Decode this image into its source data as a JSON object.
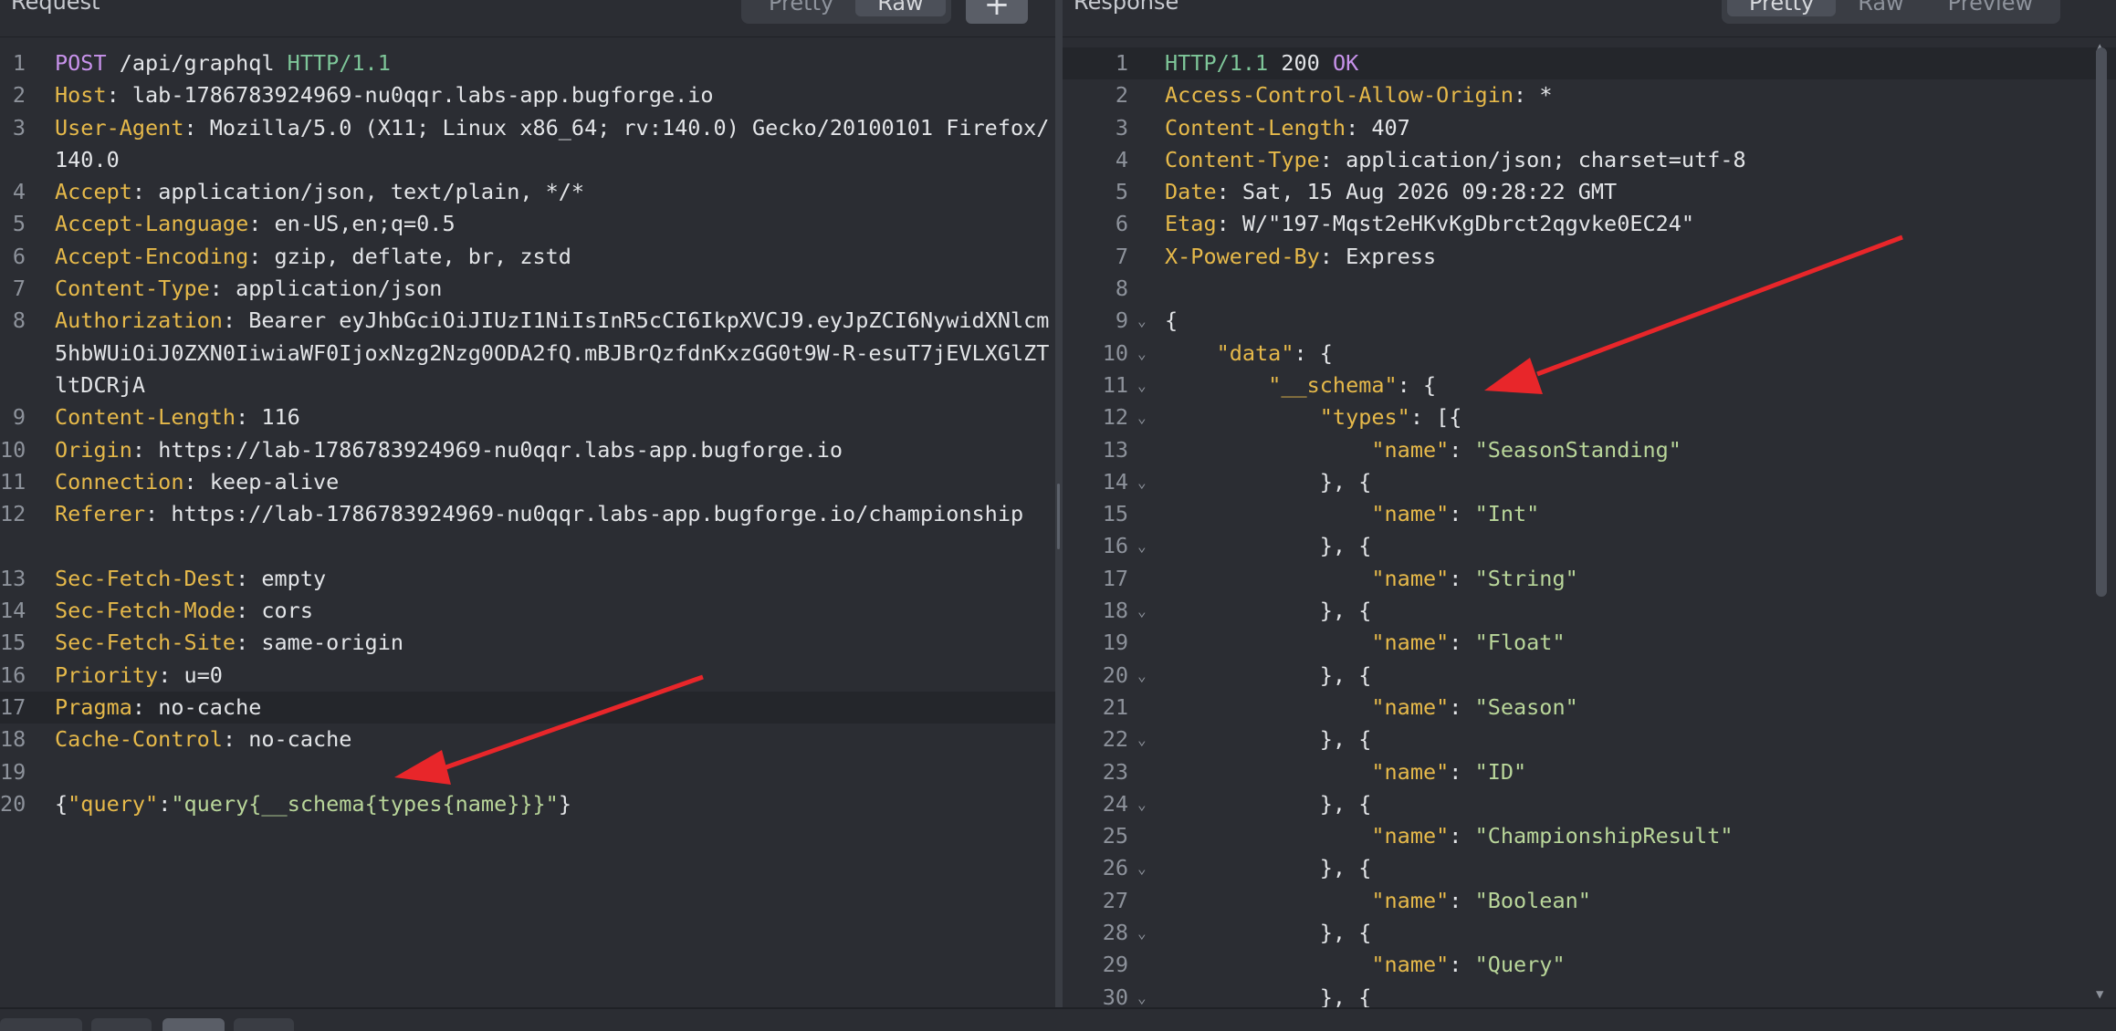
{
  "request": {
    "title": "Request",
    "tabs": [
      {
        "label": "Pretty"
      },
      {
        "label": "Raw"
      }
    ],
    "active_tab": "Raw",
    "add_label": "+",
    "lines": [
      {
        "n": "1",
        "method": "POST",
        "path": " /api/graphql ",
        "proto": "HTTP/1.1"
      },
      {
        "n": "2",
        "key": "Host",
        "value": "lab-1786783924969-nu0qqr.labs-app.bugforge.io"
      },
      {
        "n": "3",
        "key": "User-Agent",
        "value": "Mozilla/5.0 (X11; Linux x86_64; rv:140.0) Gecko/20100101 Firefox/140.0"
      },
      {
        "n": "4",
        "key": "Accept",
        "value": "application/json, text/plain, */*"
      },
      {
        "n": "5",
        "key": "Accept-Language",
        "value": "en-US,en;q=0.5"
      },
      {
        "n": "6",
        "key": "Accept-Encoding",
        "value": "gzip, deflate, br, zstd"
      },
      {
        "n": "7",
        "key": "Content-Type",
        "value": "application/json"
      },
      {
        "n": "8",
        "key": "Authorization",
        "value": "Bearer eyJhbGciOiJIUzI1NiIsInR5cCI6IkpXVCJ9.eyJpZCI6NywidXNlcm5hbWUiOiJ0ZXN0IiwiaWF0IjoxNzg2Nzg0ODA2fQ.mBJBrQzfdnKxzGG0t9W-R-esuT7jEVLXGlZTltDCRjA"
      },
      {
        "n": "9",
        "key": "Content-Length",
        "value": "116"
      },
      {
        "n": "10",
        "key": "Origin",
        "value": "https://lab-1786783924969-nu0qqr.labs-app.bugforge.io"
      },
      {
        "n": "11",
        "key": "Connection",
        "value": "keep-alive"
      },
      {
        "n": "12",
        "key": "Referer",
        "value": "https://lab-1786783924969-nu0qqr.labs-app.bugforge.io/championship"
      },
      {
        "n": "13",
        "key": "Sec-Fetch-Dest",
        "value": "empty"
      },
      {
        "n": "14",
        "key": "Sec-Fetch-Mode",
        "value": "cors"
      },
      {
        "n": "15",
        "key": "Sec-Fetch-Site",
        "value": "same-origin"
      },
      {
        "n": "16",
        "key": "Priority",
        "value": "u=0"
      },
      {
        "n": "17",
        "key": "Pragma",
        "value": "no-cache"
      },
      {
        "n": "18",
        "key": "Cache-Control",
        "value": "no-cache"
      },
      {
        "n": "19"
      },
      {
        "n": "20",
        "b1": "{",
        "k": "\"query\"",
        "colon": ":",
        "v": "\"query{__schema{types{name}}}\"",
        "b2": "}"
      }
    ]
  },
  "response": {
    "title": "Response",
    "tabs": [
      {
        "label": "Pretty"
      },
      {
        "label": "Raw"
      },
      {
        "label": "Preview"
      }
    ],
    "active_tab": "Pretty",
    "status_line": {
      "proto": "HTTP/1.1",
      "code": "200",
      "reason": "OK"
    },
    "headers": [
      {
        "n": "2",
        "key": "Access-Control-Allow-Origin",
        "value": "*"
      },
      {
        "n": "3",
        "key": "Content-Length",
        "value": "407"
      },
      {
        "n": "4",
        "key": "Content-Type",
        "value": "application/json; charset=utf-8"
      },
      {
        "n": "5",
        "key": "Date",
        "value": "Sat, 15 Aug 2026 09:28:22 GMT"
      },
      {
        "n": "6",
        "key": "Etag",
        "value": "W/\"197-Mqst2eHKvKgDbrct2qgvke0EC24\""
      },
      {
        "n": "7",
        "key": "X-Powered-By",
        "value": "Express"
      }
    ],
    "body_lines": [
      {
        "n": "8",
        "fold": false,
        "indent": "",
        "parts": []
      },
      {
        "n": "9",
        "fold": true,
        "indent": "",
        "parts": [
          {
            "c": "jpunct",
            "t": "{"
          }
        ]
      },
      {
        "n": "10",
        "fold": true,
        "indent": "    ",
        "parts": [
          {
            "c": "jkey",
            "t": "\"data\""
          },
          {
            "c": "jpunct",
            "t": ": {"
          }
        ]
      },
      {
        "n": "11",
        "fold": true,
        "indent": "        ",
        "parts": [
          {
            "c": "jkey",
            "t": "\"__schema\""
          },
          {
            "c": "jpunct",
            "t": ": {"
          }
        ]
      },
      {
        "n": "12",
        "fold": true,
        "indent": "            ",
        "parts": [
          {
            "c": "jkey",
            "t": "\"types\""
          },
          {
            "c": "jpunct",
            "t": ": [{"
          }
        ]
      },
      {
        "n": "13",
        "fold": false,
        "indent": "                ",
        "parts": [
          {
            "c": "jkey",
            "t": "\"name\""
          },
          {
            "c": "jpunct",
            "t": ": "
          },
          {
            "c": "jstr",
            "t": "\"SeasonStanding\""
          }
        ]
      },
      {
        "n": "14",
        "fold": true,
        "indent": "            ",
        "parts": [
          {
            "c": "jpunct",
            "t": "}, {"
          }
        ]
      },
      {
        "n": "15",
        "fold": false,
        "indent": "                ",
        "parts": [
          {
            "c": "jkey",
            "t": "\"name\""
          },
          {
            "c": "jpunct",
            "t": ": "
          },
          {
            "c": "jstr",
            "t": "\"Int\""
          }
        ]
      },
      {
        "n": "16",
        "fold": true,
        "indent": "            ",
        "parts": [
          {
            "c": "jpunct",
            "t": "}, {"
          }
        ]
      },
      {
        "n": "17",
        "fold": false,
        "indent": "                ",
        "parts": [
          {
            "c": "jkey",
            "t": "\"name\""
          },
          {
            "c": "jpunct",
            "t": ": "
          },
          {
            "c": "jstr",
            "t": "\"String\""
          }
        ]
      },
      {
        "n": "18",
        "fold": true,
        "indent": "            ",
        "parts": [
          {
            "c": "jpunct",
            "t": "}, {"
          }
        ]
      },
      {
        "n": "19",
        "fold": false,
        "indent": "                ",
        "parts": [
          {
            "c": "jkey",
            "t": "\"name\""
          },
          {
            "c": "jpunct",
            "t": ": "
          },
          {
            "c": "jstr",
            "t": "\"Float\""
          }
        ]
      },
      {
        "n": "20",
        "fold": true,
        "indent": "            ",
        "parts": [
          {
            "c": "jpunct",
            "t": "}, {"
          }
        ]
      },
      {
        "n": "21",
        "fold": false,
        "indent": "                ",
        "parts": [
          {
            "c": "jkey",
            "t": "\"name\""
          },
          {
            "c": "jpunct",
            "t": ": "
          },
          {
            "c": "jstr",
            "t": "\"Season\""
          }
        ]
      },
      {
        "n": "22",
        "fold": true,
        "indent": "            ",
        "parts": [
          {
            "c": "jpunct",
            "t": "}, {"
          }
        ]
      },
      {
        "n": "23",
        "fold": false,
        "indent": "                ",
        "parts": [
          {
            "c": "jkey",
            "t": "\"name\""
          },
          {
            "c": "jpunct",
            "t": ": "
          },
          {
            "c": "jstr",
            "t": "\"ID\""
          }
        ]
      },
      {
        "n": "24",
        "fold": true,
        "indent": "            ",
        "parts": [
          {
            "c": "jpunct",
            "t": "}, {"
          }
        ]
      },
      {
        "n": "25",
        "fold": false,
        "indent": "                ",
        "parts": [
          {
            "c": "jkey",
            "t": "\"name\""
          },
          {
            "c": "jpunct",
            "t": ": "
          },
          {
            "c": "jstr",
            "t": "\"ChampionshipResult\""
          }
        ]
      },
      {
        "n": "26",
        "fold": true,
        "indent": "            ",
        "parts": [
          {
            "c": "jpunct",
            "t": "}, {"
          }
        ]
      },
      {
        "n": "27",
        "fold": false,
        "indent": "                ",
        "parts": [
          {
            "c": "jkey",
            "t": "\"name\""
          },
          {
            "c": "jpunct",
            "t": ": "
          },
          {
            "c": "jstr",
            "t": "\"Boolean\""
          }
        ]
      },
      {
        "n": "28",
        "fold": true,
        "indent": "            ",
        "parts": [
          {
            "c": "jpunct",
            "t": "}, {"
          }
        ]
      },
      {
        "n": "29",
        "fold": false,
        "indent": "                ",
        "parts": [
          {
            "c": "jkey",
            "t": "\"name\""
          },
          {
            "c": "jpunct",
            "t": ": "
          },
          {
            "c": "jstr",
            "t": "\"Query\""
          }
        ]
      },
      {
        "n": "30",
        "fold": true,
        "indent": "            ",
        "parts": [
          {
            "c": "jpunct",
            "t": "}, {"
          }
        ]
      }
    ]
  },
  "colors": {
    "accent_arrow": "#e8262a",
    "header_key": "#e6b94a",
    "method": "#c792ea",
    "protocol": "#7ec699",
    "json_string": "#b9d69a"
  }
}
